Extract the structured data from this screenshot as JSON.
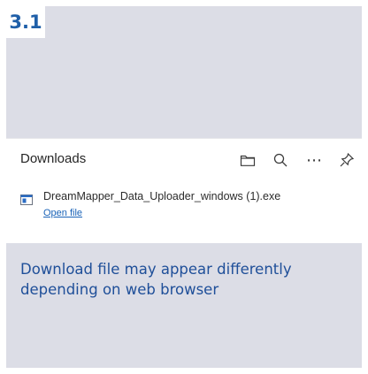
{
  "step": {
    "label": "3.1"
  },
  "downloads_panel": {
    "title": "Downloads",
    "icons": [
      "folder-icon",
      "search-icon",
      "more-icon",
      "pin-icon"
    ],
    "more_glyph": "⋯",
    "items": [
      {
        "file_name": "DreamMapper_Data_Uploader_windows (1).exe",
        "action": "Open file"
      }
    ]
  },
  "caption": {
    "text": "Download file may appear differently depending on web browser"
  },
  "colors": {
    "accent": "#1f5fa8",
    "background": "#dcdde6",
    "link": "#1a63b8"
  }
}
